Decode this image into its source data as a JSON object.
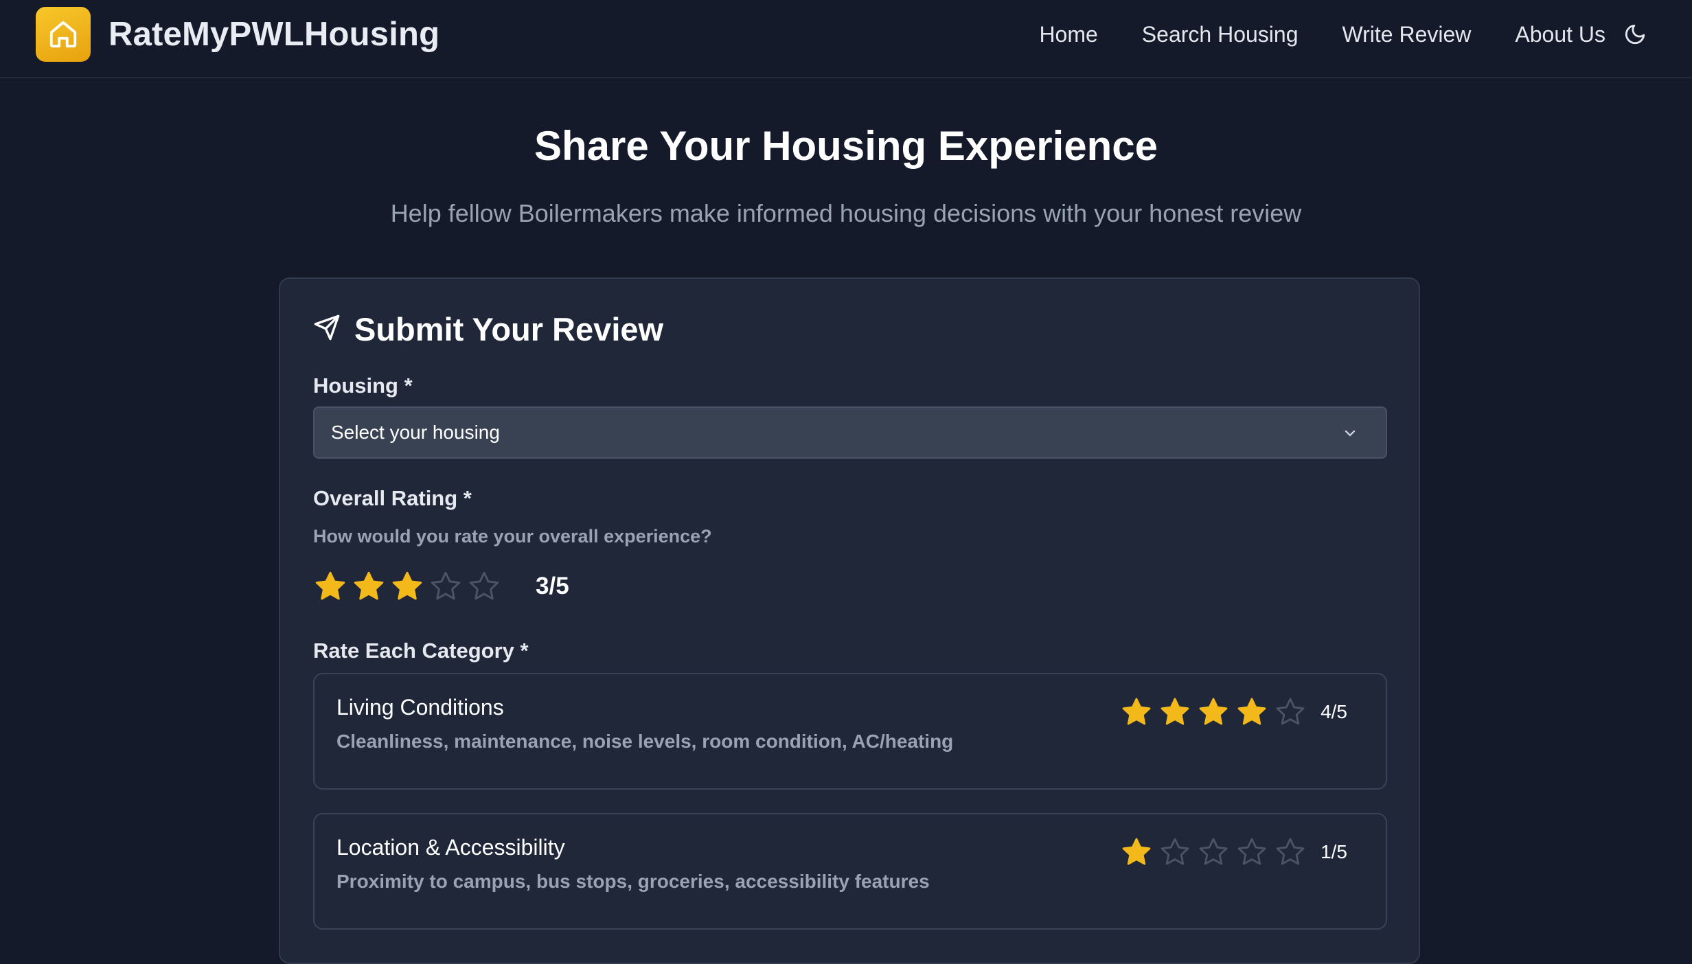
{
  "colors": {
    "accent": "#f3b81a",
    "background": "#141a29",
    "card": "#1f2738",
    "star_empty": "#4b5566"
  },
  "nav": {
    "brand": "RateMyPWLHousing",
    "logo_icon": "home-icon",
    "links": [
      "Home",
      "Search Housing",
      "Write Review",
      "About Us"
    ],
    "theme_icon": "moon-icon"
  },
  "hero": {
    "title": "Share Your Housing Experience",
    "subtitle": "Help fellow Boilermakers make informed housing decisions with your honest review"
  },
  "form": {
    "title": "Submit Your Review",
    "title_icon": "send-icon",
    "housing_label": "Housing *",
    "housing_placeholder": "Select your housing",
    "overall_label": "Overall Rating *",
    "overall_hint": "How would you rate your overall experience?",
    "overall_rating": 3,
    "overall_max": 5,
    "overall_text": "3/5",
    "categories_label": "Rate Each Category *",
    "categories": [
      {
        "name": "Living Conditions",
        "description": "Cleanliness, maintenance, noise levels, room condition, AC/heating",
        "rating": 4,
        "text": "4/5"
      },
      {
        "name": "Location & Accessibility",
        "description": "Proximity to campus, bus stops, groceries, accessibility features",
        "rating": 1,
        "text": "1/5"
      }
    ]
  }
}
